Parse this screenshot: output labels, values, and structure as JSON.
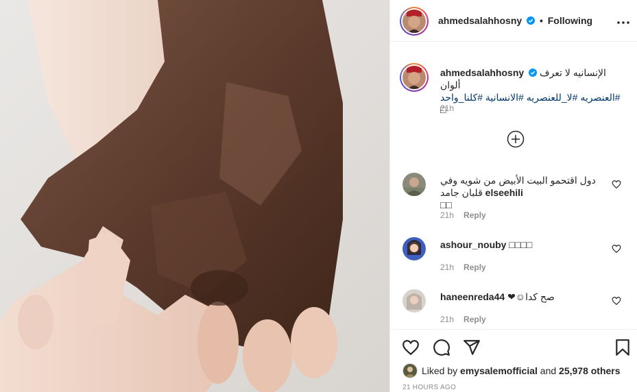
{
  "post": {
    "image_alt": "Two hands clasped together, one dark-skinned and one light-skinned"
  },
  "header": {
    "username": "ahmedsalahhosny",
    "separator": "•",
    "follow_status": "Following",
    "more_icon": "more-horizontal-icon"
  },
  "caption": {
    "username": "ahmedsalahhosny",
    "text": "الإنسانيه لا تعرف ألوان",
    "hashtags": "#العنصريه #لا_للعنصريه #الانسانية #كلنا_واحد",
    "trailing_glyph": "□",
    "time": "21h"
  },
  "comments": [
    {
      "username": "elseehili",
      "text": "دول اقتحمو البيت الأبيض من شويه وفي قلبان جامد",
      "glyphs": "□□",
      "time": "21h",
      "reply_label": "Reply"
    },
    {
      "username": "ashour_nouby",
      "text": "□□□□",
      "glyphs": "",
      "time": "21h",
      "reply_label": "Reply"
    },
    {
      "username": "haneenreda44",
      "text": "صح كدا☺❤",
      "glyphs": "",
      "time": "21h",
      "reply_label": "Reply"
    }
  ],
  "actions": {
    "like_icon": "heart-icon",
    "comment_icon": "comment-icon",
    "share_icon": "paper-plane-icon",
    "save_icon": "bookmark-icon"
  },
  "likes": {
    "prefix": "Liked by",
    "user": "emysalemofficial",
    "middle": "and",
    "count": "25,978 others"
  },
  "timestamp": "21 HOURS AGO",
  "colors": {
    "link": "#00376b",
    "muted": "#8e8e8e",
    "verified": "#0095f6",
    "text": "#262626"
  }
}
